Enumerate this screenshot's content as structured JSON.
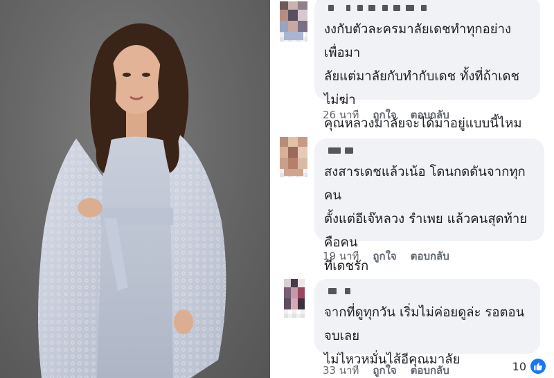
{
  "comments": [
    {
      "text": "งงกับตัวละครมาลัยเดชทำทุกอย่างเพื่อมา\nลัยแต่มาลัยกับทำกับเดช  ทั้งที่ถ้าเดชไม่ฆ่า\nคุณหลวงมาลัยจะได้มาอยู่แบบนี้ไหม",
      "time": "26 นาที",
      "like_label": "ถูกใจ",
      "reply_label": "ตอบกลับ"
    },
    {
      "text": "สงสารเดชแล้วเน้อ  โดนกดดันจากทุกคน\nตั้งแต่อีเจ๊หลวง รำเพย แล้วคนสุดท้ายคือคน\nที่เดชรัก",
      "time": "19 นาที",
      "like_label": "ถูกใจ",
      "reply_label": "ตอบกลับ"
    },
    {
      "text": "จากที่ดูทุกวัน เริ่มไม่ค่อยดูล่ะ รอตอนจบเลย\nไม่ไหวหมั่นไส้อีคุณมาลัย",
      "time": "33 นาที",
      "like_label": "ถูกใจ",
      "reply_label": "ตอบกลับ",
      "reaction_count": "10"
    }
  ],
  "icons": {
    "like_reaction": "thumbs-up-icon"
  },
  "colors": {
    "bubble": "#f0f2f5",
    "like_blue": "#1877f2",
    "meta_text": "#65676b"
  }
}
